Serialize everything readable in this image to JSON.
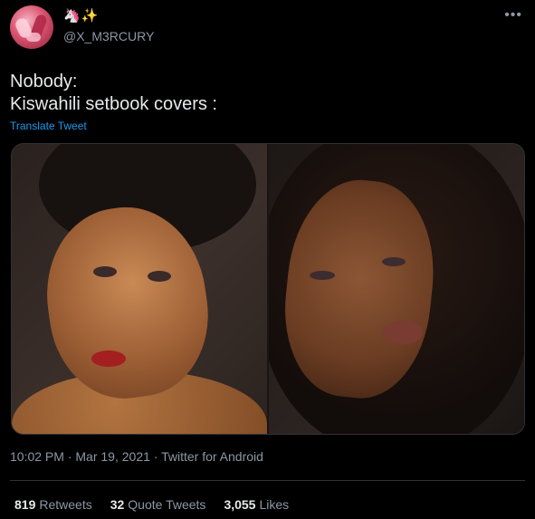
{
  "user": {
    "display_name": "🦄✨",
    "handle": "@X_M3RCURY"
  },
  "header": {
    "more_icon": "•••"
  },
  "tweet": {
    "text": "Nobody:\nKiswahili setbook covers :",
    "translate_label": "Translate Tweet"
  },
  "meta": {
    "time": "10:02 PM",
    "separator1": " · ",
    "date": "Mar 19, 2021",
    "separator2": " · ",
    "source": "Twitter for Android"
  },
  "stats": {
    "retweets_count": "819",
    "retweets_label": "Retweets",
    "quote_count": "32",
    "quote_label": "Quote Tweets",
    "likes_count": "3,055",
    "likes_label": "Likes"
  },
  "colors": {
    "background": "#000000",
    "link": "#1d9bf0",
    "muted": "#8b98a5",
    "text": "#e7e9ea"
  }
}
